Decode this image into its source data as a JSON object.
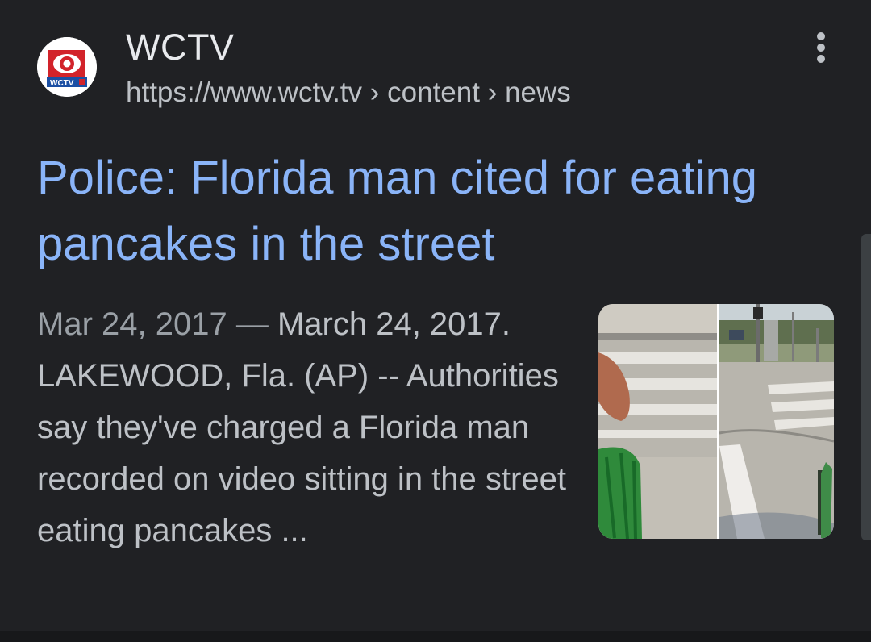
{
  "result": {
    "site_name": "WCTV",
    "url_host": "https://www.wctv.tv",
    "url_path_1": "content",
    "url_path_2": "news",
    "breadcrumb_separator": "›",
    "favicon": {
      "icon": "wctv-logo-icon",
      "text": "WCTV",
      "brand_color": "#d2232a"
    },
    "title": "Police: Florida man cited for eating pancakes in the street",
    "date": "Mar 24, 2017",
    "date_separator": "—",
    "snippet": "March 24, 2017. LAKEWOOD, Fla. (AP) -- Authorities say they've charged a Florida man recorded on video sitting in the street eating pancakes ...",
    "thumbnail": {
      "icon": "street-photo-thumbnail"
    }
  },
  "menu": {
    "icon": "more-vert-icon"
  },
  "colors": {
    "background": "#202124",
    "title_link": "#8ab4f8",
    "primary_text": "#e8eaed",
    "secondary_text": "#bdc1c6"
  }
}
